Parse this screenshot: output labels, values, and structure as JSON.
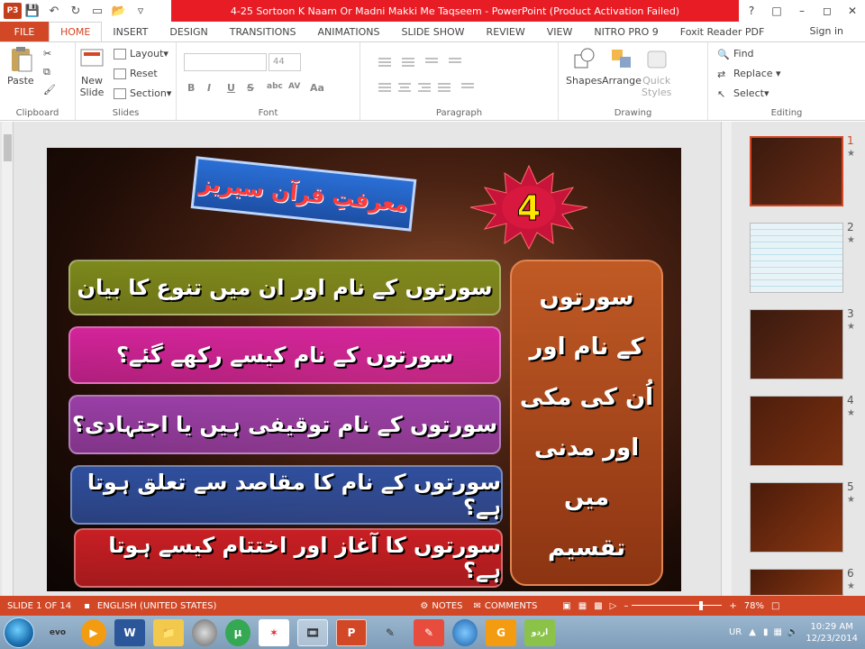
{
  "window": {
    "title": "4-25  Sortoon K Naam Or Madni Makki Me Taqseem -  PowerPoint (Product Activation Failed)",
    "app_icon": "P3",
    "help": "?",
    "accent": "#d24726",
    "title_accent": "#e81c24"
  },
  "tabs": [
    "FILE",
    "HOME",
    "INSERT",
    "DESIGN",
    "TRANSITIONS",
    "ANIMATIONS",
    "SLIDE SHOW",
    "REVIEW",
    "VIEW",
    "NITRO PRO 9",
    "Foxit Reader PDF"
  ],
  "active_tab": "HOME",
  "signin": "Sign in",
  "ribbon": {
    "clipboard": {
      "label": "Clipboard",
      "paste": "Paste"
    },
    "slides": {
      "label": "Slides",
      "new_slide_1": "New",
      "new_slide_2": "Slide",
      "layout": "Layout",
      "reset": "Reset",
      "section": "Section"
    },
    "font": {
      "label": "Font",
      "size": "44",
      "bold": "B",
      "italic": "I",
      "underline": "U",
      "strike": "S",
      "shadow": "abc",
      "spacing": "AV",
      "case": "Aa"
    },
    "paragraph": {
      "label": "Paragraph"
    },
    "drawing": {
      "label": "Drawing",
      "shapes": "Shapes",
      "arrange": "Arrange",
      "quick_1": "Quick",
      "quick_2": "Styles"
    },
    "editing": {
      "label": "Editing",
      "find": "Find",
      "replace": "Replace",
      "select": "Select"
    }
  },
  "slide": {
    "banner": "معرفتِ قرآن سیریز",
    "badge": "4",
    "bars": [
      {
        "text": "سورتوں کے نام اور ان میں تنوع کا بیان",
        "color": "#7d8a1c"
      },
      {
        "text": "سورتوں کے نام کیسے رکھے گئے؟",
        "color": "#d3249a"
      },
      {
        "text": "سورتوں کے نام توقیفی ہیں یا اجتہادی؟",
        "color": "#9a3fa8"
      },
      {
        "text": "سورتوں کے نام کا مقاصد سے تعلق ہوتا ہے؟",
        "color": "#2f4f9e"
      },
      {
        "text": "سورتوں کا آغاز اور اختتام کیسے ہوتا ہے؟",
        "color": "#c81f24"
      }
    ],
    "side_lines": [
      "سورتوں",
      "کے نام اور",
      "اُن کی مکی",
      "اور مدنی",
      "میں",
      "تقسیم"
    ]
  },
  "thumbnails": [
    {
      "num": "1",
      "star": "★",
      "selected": true
    },
    {
      "num": "2",
      "star": "★",
      "selected": false
    },
    {
      "num": "3",
      "star": "★",
      "selected": false
    },
    {
      "num": "4",
      "star": "★",
      "selected": false
    },
    {
      "num": "5",
      "star": "★",
      "selected": false
    },
    {
      "num": "6",
      "star": "★",
      "selected": false
    }
  ],
  "status": {
    "slide": "SLIDE 1 OF 14",
    "language": "ENGLISH (UNITED STATES)",
    "notes": "NOTES",
    "comments": "COMMENTS",
    "zoom": "78%",
    "zoom_level": 0.78
  },
  "taskbar": {
    "apps": [
      "evo",
      "media-player",
      "W",
      "explorer",
      "chrome",
      "utorrent",
      "acrobat",
      "film",
      "P",
      "pencil",
      "pdf",
      "globe",
      "G",
      "urdu"
    ],
    "active_index": 8,
    "tray": {
      "lang": "UR",
      "time": "10:29 AM",
      "date": "12/23/2014"
    }
  }
}
